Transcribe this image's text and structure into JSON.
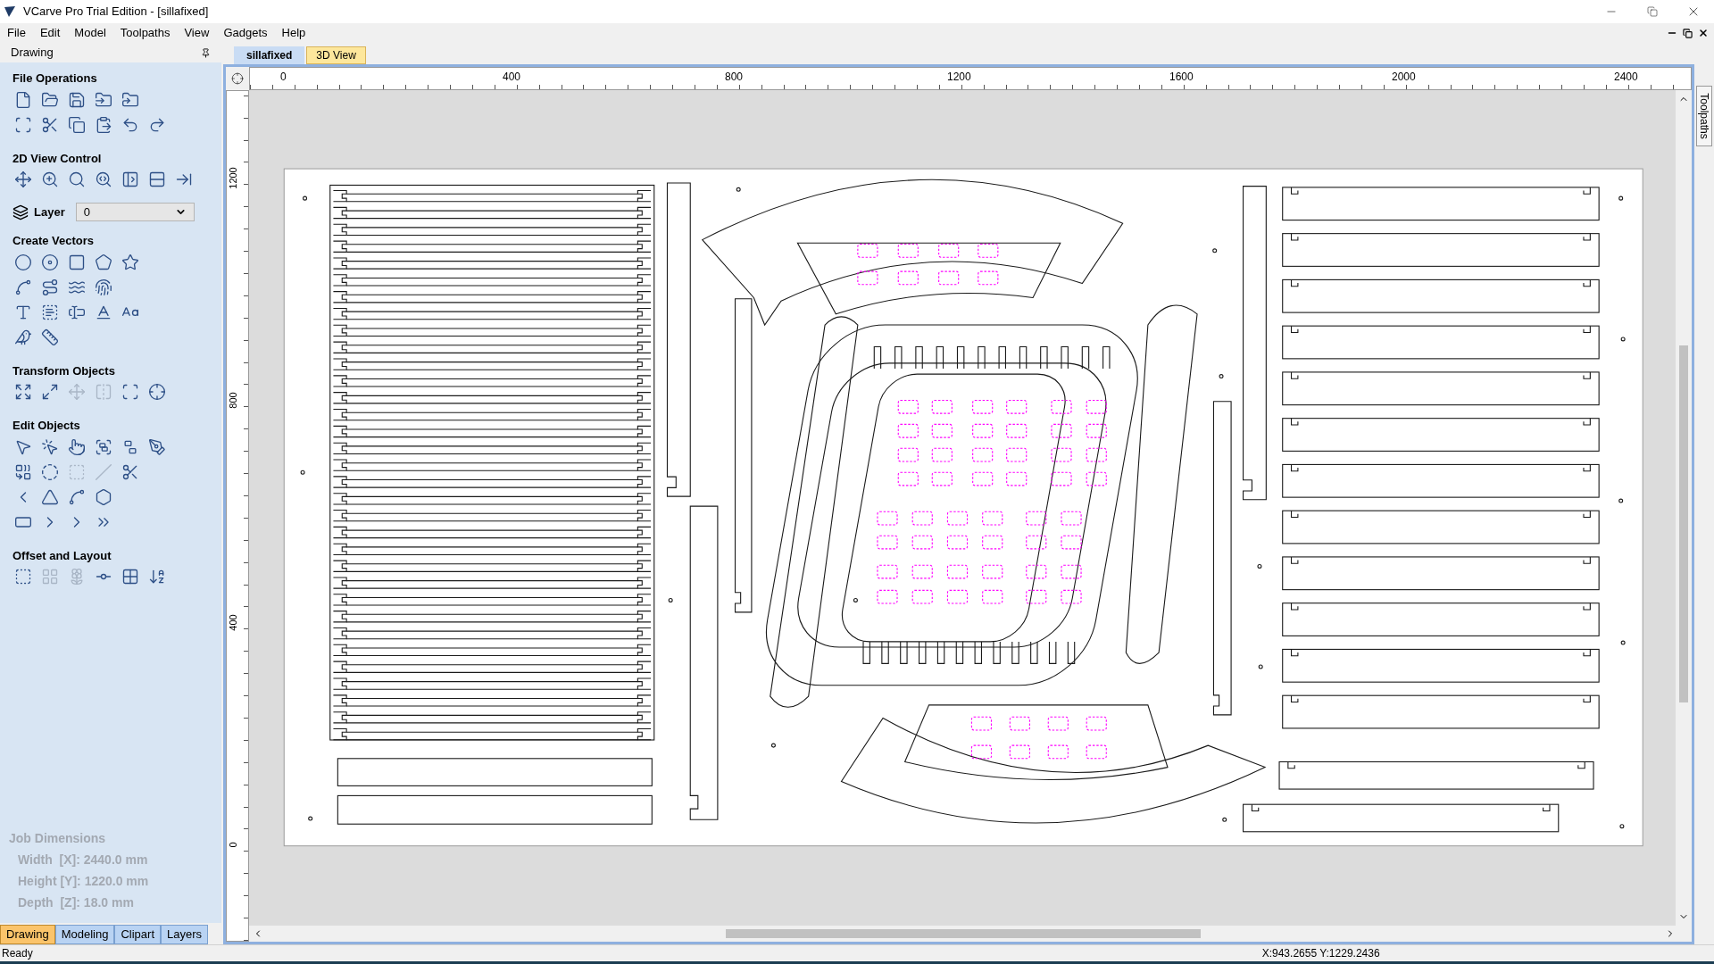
{
  "window": {
    "title": "VCarve Pro Trial Edition - [sillafixed]"
  },
  "menu": [
    "File",
    "Edit",
    "Model",
    "Toolpaths",
    "View",
    "Gadgets",
    "Help"
  ],
  "panel": {
    "title": "Drawing",
    "sections": [
      {
        "kind": "tools",
        "title": "File Operations",
        "rows": [
          [
            {
              "disabled": false
            },
            {
              "disabled": false
            },
            {
              "disabled": false
            },
            {
              "disabled": false
            },
            {
              "disabled": false
            }
          ],
          [
            {
              "disabled": false
            },
            {
              "disabled": false
            },
            {
              "disabled": false
            },
            {
              "disabled": false
            },
            {
              "disabled": false
            },
            {
              "disabled": false
            }
          ]
        ]
      },
      {
        "kind": "tools",
        "title": "2D View Control",
        "rows": [
          [
            {
              "disabled": false
            },
            {
              "disabled": false
            },
            {
              "disabled": false
            },
            {
              "disabled": false
            },
            {
              "disabled": false
            },
            {
              "disabled": false
            },
            {
              "disabled": false
            }
          ]
        ]
      },
      {
        "kind": "layer",
        "label": "Layer",
        "value": "0"
      },
      {
        "kind": "tools",
        "title": "Create Vectors",
        "rows": [
          [
            {
              "disabled": false
            },
            {
              "disabled": false
            },
            {
              "disabled": false
            },
            {
              "disabled": false
            },
            {
              "disabled": false
            }
          ],
          [
            {
              "disabled": false
            },
            {
              "disabled": false
            },
            {
              "disabled": false
            },
            {
              "disabled": false
            }
          ],
          [
            {
              "disabled": false
            },
            {
              "disabled": false
            },
            {
              "disabled": false
            },
            {
              "disabled": false
            },
            {
              "disabled": false
            }
          ],
          [
            {
              "disabled": false
            },
            {
              "disabled": false
            }
          ]
        ]
      },
      {
        "kind": "tools",
        "title": "Transform Objects",
        "rows": [
          [
            {
              "disabled": false
            },
            {
              "disabled": false
            },
            {
              "disabled": true
            },
            {
              "disabled": true
            },
            {
              "disabled": false
            },
            {
              "disabled": false
            }
          ]
        ]
      },
      {
        "kind": "tools",
        "title": "Edit Objects",
        "rows": [
          [
            {
              "disabled": false
            },
            {
              "disabled": false
            },
            {
              "disabled": false
            },
            {
              "disabled": false
            },
            {
              "disabled": false
            },
            {
              "disabled": false
            }
          ],
          [
            {
              "disabled": false
            },
            {
              "disabled": false
            },
            {
              "disabled": true
            },
            {
              "disabled": true
            },
            {
              "disabled": false
            }
          ],
          [
            {
              "disabled": false
            },
            {
              "disabled": false
            },
            {
              "disabled": false
            },
            {
              "disabled": false
            }
          ],
          [
            {
              "disabled": false
            },
            {
              "disabled": false
            },
            {
              "disabled": false
            },
            {
              "disabled": false
            }
          ]
        ]
      },
      {
        "kind": "tools",
        "title": "Offset and Layout",
        "rows": [
          [
            {
              "disabled": false
            },
            {
              "disabled": true
            },
            {
              "disabled": true
            },
            {
              "disabled": false
            },
            {
              "disabled": false
            },
            {
              "disabled": false
            }
          ]
        ]
      }
    ],
    "job_dimensions": {
      "title": "Job Dimensions",
      "lines": [
        "Width  [X]: 2440.0 mm",
        "Height [Y]: 1220.0 mm",
        "Depth  [Z]: 18.0 mm"
      ]
    },
    "tabs": [
      {
        "label": "Drawing",
        "selected": true
      },
      {
        "label": "Modeling",
        "selected": false
      },
      {
        "label": "Clipart",
        "selected": false
      },
      {
        "label": "Layers",
        "selected": false
      }
    ]
  },
  "document_tabs": [
    {
      "label": "sillafixed",
      "selected": true
    },
    {
      "label": "3D View",
      "selected": false
    }
  ],
  "ruler_horizontal": [
    "0",
    "400",
    "800",
    "1200",
    "1600",
    "2000",
    "2400"
  ],
  "ruler_vertical": [
    "1200",
    "800",
    "400",
    "0"
  ],
  "side_tab": "Toolpaths",
  "status_bar": {
    "text": "Ready",
    "coords": "X:943.2655 Y:1229.2436"
  }
}
